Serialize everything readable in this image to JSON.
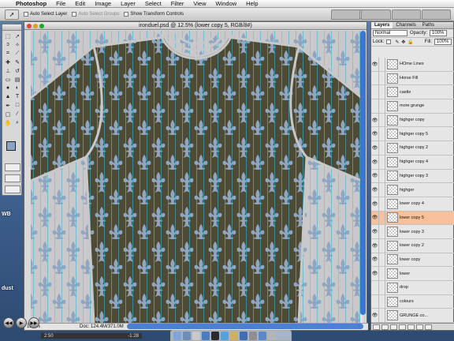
{
  "app": {
    "name": "Photoshop",
    "menus": [
      "File",
      "Edit",
      "Image",
      "Layer",
      "Select",
      "Filter",
      "View",
      "Window",
      "Help"
    ]
  },
  "options_bar": {
    "auto_select_layer": "Auto Select Layer",
    "auto_select_groups": "Auto Select Groups",
    "show_transform_controls": "Show Transform Controls"
  },
  "document": {
    "title": "ironduel.psd @ 12.5% (lower copy 5, RGB/8#)",
    "zoom": "12.5%",
    "doc_size": "Doc: 124.4M/371.0M"
  },
  "layers_panel": {
    "tabs": [
      "Layers",
      "Channels",
      "Paths"
    ],
    "blend_mode": "Normal",
    "opacity_label": "Opacity:",
    "opacity_value": "100%",
    "lock_label": "Lock:",
    "fill_label": "Fill:",
    "fill_value": "100%",
    "layers": [
      {
        "name": "HOme Lines",
        "visible": true,
        "selected": false
      },
      {
        "name": "Horse Fill",
        "visible": false,
        "selected": false
      },
      {
        "name": "castle",
        "visible": false,
        "selected": false
      },
      {
        "name": "more grunge",
        "visible": false,
        "selected": false
      },
      {
        "name": "highger copy",
        "visible": true,
        "selected": false
      },
      {
        "name": "highger copy 5",
        "visible": true,
        "selected": false
      },
      {
        "name": "highger copy 2",
        "visible": true,
        "selected": false
      },
      {
        "name": "highger copy 4",
        "visible": true,
        "selected": false
      },
      {
        "name": "highger copy 3",
        "visible": true,
        "selected": false
      },
      {
        "name": "highger",
        "visible": true,
        "selected": false
      },
      {
        "name": "lower copy 4",
        "visible": true,
        "selected": false
      },
      {
        "name": "lower copy 5",
        "visible": true,
        "selected": true
      },
      {
        "name": "lower copy 3",
        "visible": true,
        "selected": false
      },
      {
        "name": "lower copy 2",
        "visible": true,
        "selected": false
      },
      {
        "name": "lower copy",
        "visible": true,
        "selected": false
      },
      {
        "name": "lower",
        "visible": true,
        "selected": false
      },
      {
        "name": "drop",
        "visible": false,
        "selected": false
      },
      {
        "name": "colours",
        "visible": false,
        "selected": false
      },
      {
        "name": "GRUNGE co...",
        "visible": true,
        "selected": false
      }
    ]
  },
  "desktop": {
    "labels": [
      "WB",
      "dust"
    ]
  },
  "media": {
    "elapsed": "2:50",
    "remaining": "-1:28"
  },
  "colors": {
    "shirt": "#4d4a36",
    "pattern": "#8ea6c2",
    "stripe_blue": "#37b0cc",
    "stripe_pink": "#d58ca6",
    "selection_highlight": "#f7c09a"
  }
}
